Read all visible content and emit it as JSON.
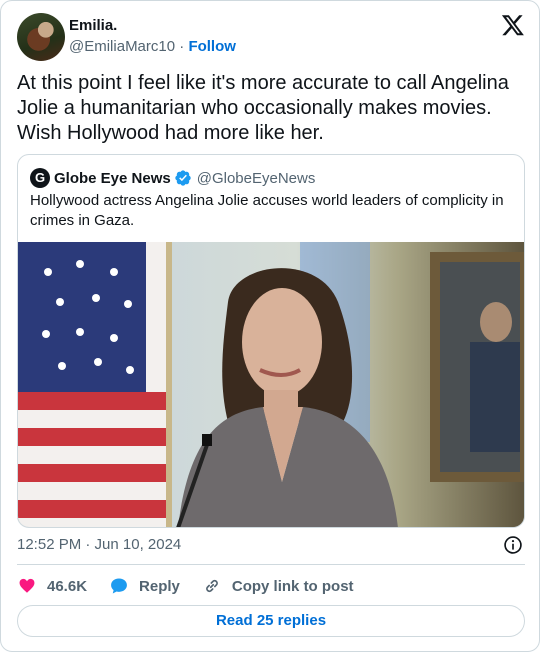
{
  "author": {
    "display_name": "Emilia.",
    "handle": "@EmiliaMarc10",
    "separator": "·",
    "follow_label": "Follow"
  },
  "tweet": {
    "text": "At this point I feel like it's more accurate to call Angelina Jolie a humanitarian who occasionally makes movies. Wish Hollywood had more like her."
  },
  "quoted": {
    "avatar_letter": "G",
    "display_name": "Globe Eye News",
    "handle": "@GlobeEyeNews",
    "text": "Hollywood actress Angelina Jolie accuses world leaders of complicity in crimes in Gaza."
  },
  "meta": {
    "timestamp": "12:52 PM · Jun 10, 2024"
  },
  "actions": {
    "likes": "46.6K",
    "reply_label": "Reply",
    "copy_label": "Copy link to post"
  },
  "read_replies_label": "Read 25 replies",
  "colors": {
    "accent": "#006fd6",
    "like": "#f91880",
    "reply_bubble": "#1d9bf0",
    "verified": "#1d9bf0",
    "muted": "#536471"
  },
  "icons": [
    "x-logo-icon",
    "verified-badge-icon",
    "info-icon",
    "heart-icon",
    "reply-bubble-icon",
    "link-icon"
  ]
}
